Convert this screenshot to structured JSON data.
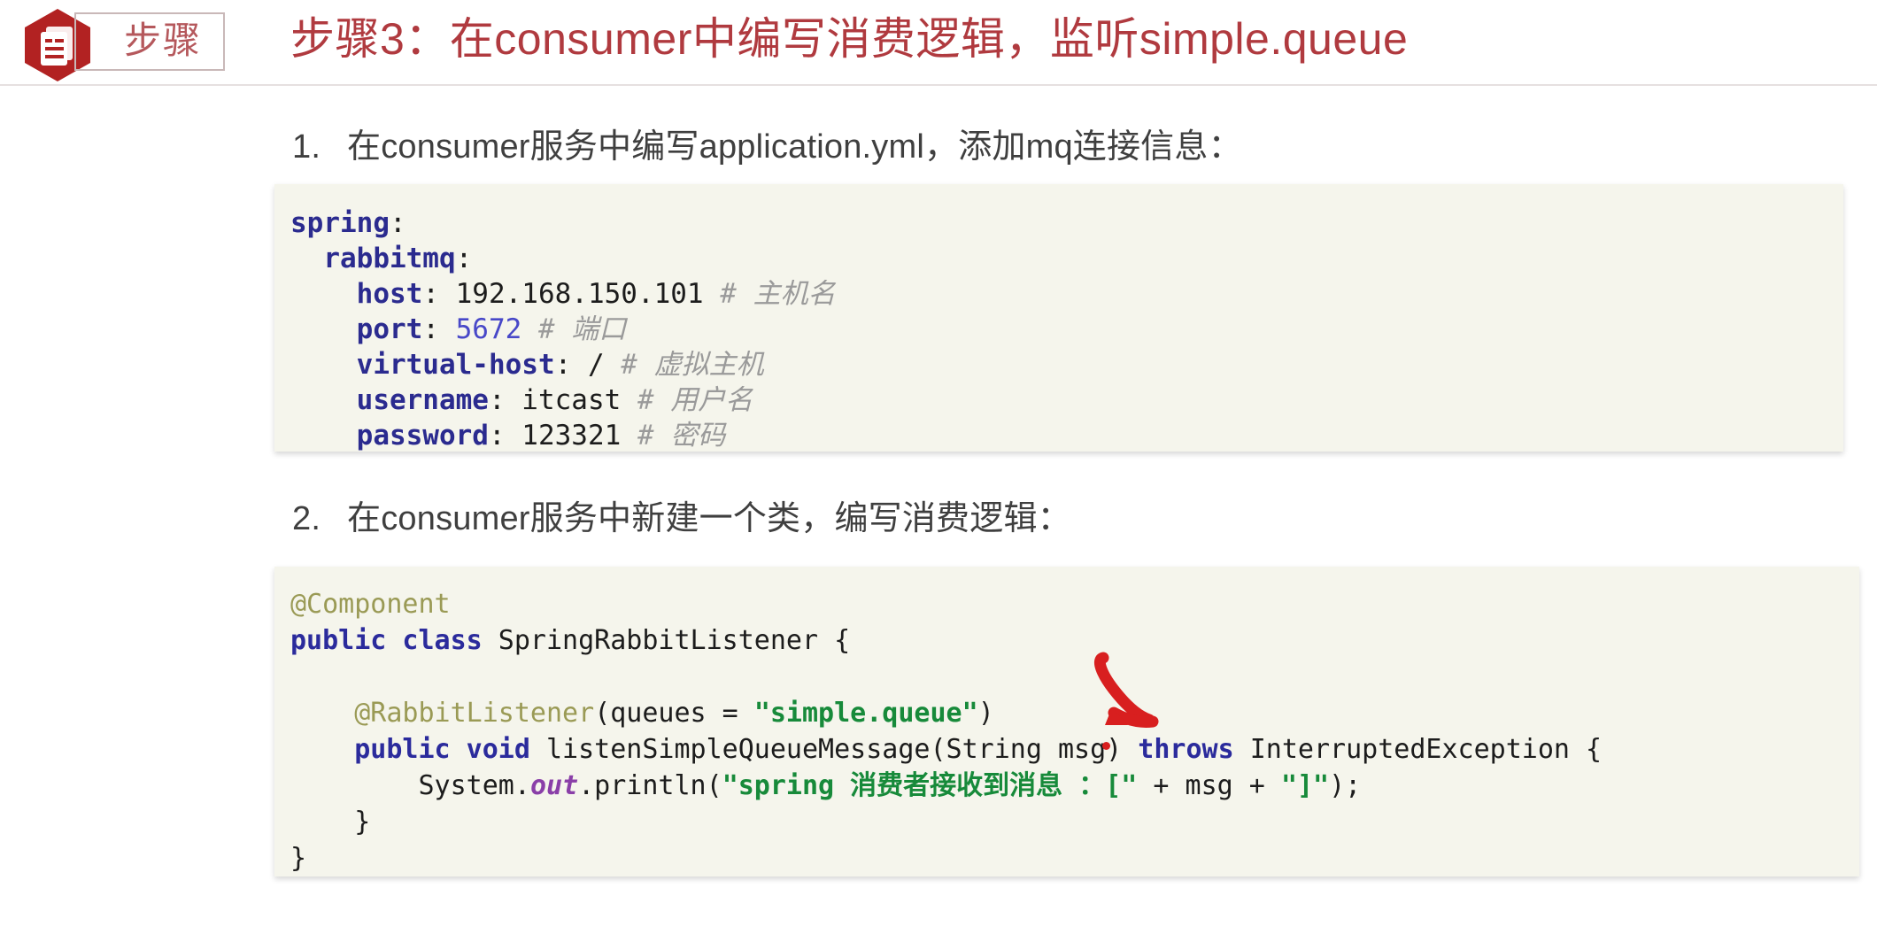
{
  "header": {
    "icon_name": "hexagon-document-icon",
    "badge_label": "步骤",
    "title": "步骤3：在consumer中编写消费逻辑，监听simple.queue",
    "title_color": "#b03a3f",
    "badge_color": "#b5585c",
    "hex_color": "#b22222"
  },
  "steps": [
    {
      "number": "1.",
      "text": "在consumer服务中编写application.yml，添加mq连接信息："
    },
    {
      "number": "2.",
      "text": "在consumer服务中新建一个类，编写消费逻辑："
    }
  ],
  "yaml_code": {
    "language": "yaml",
    "lines": [
      [
        {
          "t": "spring",
          "c": "key"
        },
        {
          "t": ":",
          "c": "plain"
        }
      ],
      [
        {
          "t": "  ",
          "c": "plain"
        },
        {
          "t": "rabbitmq",
          "c": "key"
        },
        {
          "t": ":",
          "c": "plain"
        }
      ],
      [
        {
          "t": "    ",
          "c": "plain"
        },
        {
          "t": "host",
          "c": "key"
        },
        {
          "t": ": 192.168.150.101 ",
          "c": "plain"
        },
        {
          "t": "# 主机名",
          "c": "cmt"
        }
      ],
      [
        {
          "t": "    ",
          "c": "plain"
        },
        {
          "t": "port",
          "c": "key"
        },
        {
          "t": ": ",
          "c": "plain"
        },
        {
          "t": "5672",
          "c": "num"
        },
        {
          "t": " ",
          "c": "plain"
        },
        {
          "t": "# 端口",
          "c": "cmt"
        }
      ],
      [
        {
          "t": "    ",
          "c": "plain"
        },
        {
          "t": "virtual-host",
          "c": "key"
        },
        {
          "t": ": / ",
          "c": "plain"
        },
        {
          "t": "# 虚拟主机",
          "c": "cmt"
        }
      ],
      [
        {
          "t": "    ",
          "c": "plain"
        },
        {
          "t": "username",
          "c": "key"
        },
        {
          "t": ": itcast ",
          "c": "plain"
        },
        {
          "t": "# 用户名",
          "c": "cmt"
        }
      ],
      [
        {
          "t": "    ",
          "c": "plain"
        },
        {
          "t": "password",
          "c": "key"
        },
        {
          "t": ": 123321 ",
          "c": "plain"
        },
        {
          "t": "# 密码",
          "c": "cmt"
        }
      ]
    ],
    "plain_text": "spring:\n  rabbitmq:\n    host: 192.168.150.101 # 主机名\n    port: 5672 # 端口\n    virtual-host: / # 虚拟主机\n    username: itcast # 用户名\n    password: 123321 # 密码"
  },
  "java_code": {
    "language": "java",
    "lines": [
      [
        {
          "t": "@Component",
          "c": "ann"
        }
      ],
      [
        {
          "t": "public class",
          "c": "kw"
        },
        {
          "t": " SpringRabbitListener {",
          "c": "plain"
        }
      ],
      [
        {
          "t": "",
          "c": "plain"
        }
      ],
      [
        {
          "t": "    ",
          "c": "plain"
        },
        {
          "t": "@RabbitListener",
          "c": "ann"
        },
        {
          "t": "(queues = ",
          "c": "plain"
        },
        {
          "t": "\"simple.queue\"",
          "c": "str"
        },
        {
          "t": ")",
          "c": "plain"
        }
      ],
      [
        {
          "t": "    ",
          "c": "plain"
        },
        {
          "t": "public void",
          "c": "kw"
        },
        {
          "t": " listenSimpleQueueMessage(String msg) ",
          "c": "plain"
        },
        {
          "t": "throws",
          "c": "kw"
        },
        {
          "t": " InterruptedException {",
          "c": "plain"
        }
      ],
      [
        {
          "t": "        System.",
          "c": "plain"
        },
        {
          "t": "out",
          "c": "field"
        },
        {
          "t": ".println(",
          "c": "plain"
        },
        {
          "t": "\"spring 消费者接收到消息 ：[\"",
          "c": "str"
        },
        {
          "t": " + msg + ",
          "c": "plain"
        },
        {
          "t": "\"]\"",
          "c": "str"
        },
        {
          "t": ");",
          "c": "plain"
        }
      ],
      [
        {
          "t": "    }",
          "c": "plain"
        }
      ],
      [
        {
          "t": "}",
          "c": "plain"
        }
      ]
    ],
    "plain_text": "@Component\npublic class SpringRabbitListener {\n\n    @RabbitListener(queues = \"simple.queue\")\n    public void listenSimpleQueueMessage(String msg) throws InterruptedException {\n        System.out.println(\"spring 消费者接收到消息 ：[\" + msg + \"]\");\n    }\n}"
  },
  "annotation": {
    "name": "red-curved-arrow",
    "color": "#d81f1f",
    "points_at": "msg",
    "description": "手绘红色弯箭头指向 msg 参数"
  }
}
